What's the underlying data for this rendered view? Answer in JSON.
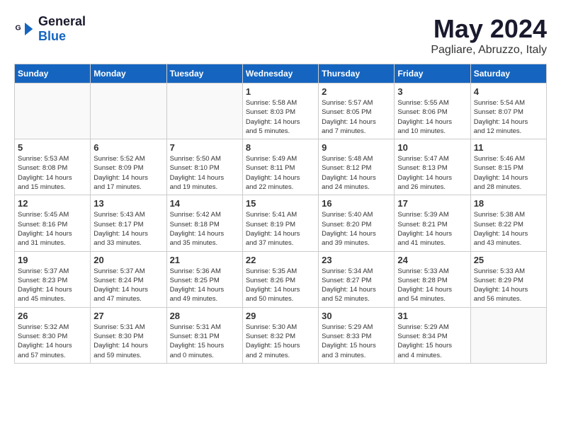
{
  "logo": {
    "general": "General",
    "blue": "Blue"
  },
  "header": {
    "month": "May 2024",
    "location": "Pagliare, Abruzzo, Italy"
  },
  "weekdays": [
    "Sunday",
    "Monday",
    "Tuesday",
    "Wednesday",
    "Thursday",
    "Friday",
    "Saturday"
  ],
  "weeks": [
    [
      {
        "day": "",
        "info": ""
      },
      {
        "day": "",
        "info": ""
      },
      {
        "day": "",
        "info": ""
      },
      {
        "day": "1",
        "info": "Sunrise: 5:58 AM\nSunset: 8:03 PM\nDaylight: 14 hours\nand 5 minutes."
      },
      {
        "day": "2",
        "info": "Sunrise: 5:57 AM\nSunset: 8:05 PM\nDaylight: 14 hours\nand 7 minutes."
      },
      {
        "day": "3",
        "info": "Sunrise: 5:55 AM\nSunset: 8:06 PM\nDaylight: 14 hours\nand 10 minutes."
      },
      {
        "day": "4",
        "info": "Sunrise: 5:54 AM\nSunset: 8:07 PM\nDaylight: 14 hours\nand 12 minutes."
      }
    ],
    [
      {
        "day": "5",
        "info": "Sunrise: 5:53 AM\nSunset: 8:08 PM\nDaylight: 14 hours\nand 15 minutes."
      },
      {
        "day": "6",
        "info": "Sunrise: 5:52 AM\nSunset: 8:09 PM\nDaylight: 14 hours\nand 17 minutes."
      },
      {
        "day": "7",
        "info": "Sunrise: 5:50 AM\nSunset: 8:10 PM\nDaylight: 14 hours\nand 19 minutes."
      },
      {
        "day": "8",
        "info": "Sunrise: 5:49 AM\nSunset: 8:11 PM\nDaylight: 14 hours\nand 22 minutes."
      },
      {
        "day": "9",
        "info": "Sunrise: 5:48 AM\nSunset: 8:12 PM\nDaylight: 14 hours\nand 24 minutes."
      },
      {
        "day": "10",
        "info": "Sunrise: 5:47 AM\nSunset: 8:13 PM\nDaylight: 14 hours\nand 26 minutes."
      },
      {
        "day": "11",
        "info": "Sunrise: 5:46 AM\nSunset: 8:15 PM\nDaylight: 14 hours\nand 28 minutes."
      }
    ],
    [
      {
        "day": "12",
        "info": "Sunrise: 5:45 AM\nSunset: 8:16 PM\nDaylight: 14 hours\nand 31 minutes."
      },
      {
        "day": "13",
        "info": "Sunrise: 5:43 AM\nSunset: 8:17 PM\nDaylight: 14 hours\nand 33 minutes."
      },
      {
        "day": "14",
        "info": "Sunrise: 5:42 AM\nSunset: 8:18 PM\nDaylight: 14 hours\nand 35 minutes."
      },
      {
        "day": "15",
        "info": "Sunrise: 5:41 AM\nSunset: 8:19 PM\nDaylight: 14 hours\nand 37 minutes."
      },
      {
        "day": "16",
        "info": "Sunrise: 5:40 AM\nSunset: 8:20 PM\nDaylight: 14 hours\nand 39 minutes."
      },
      {
        "day": "17",
        "info": "Sunrise: 5:39 AM\nSunset: 8:21 PM\nDaylight: 14 hours\nand 41 minutes."
      },
      {
        "day": "18",
        "info": "Sunrise: 5:38 AM\nSunset: 8:22 PM\nDaylight: 14 hours\nand 43 minutes."
      }
    ],
    [
      {
        "day": "19",
        "info": "Sunrise: 5:37 AM\nSunset: 8:23 PM\nDaylight: 14 hours\nand 45 minutes."
      },
      {
        "day": "20",
        "info": "Sunrise: 5:37 AM\nSunset: 8:24 PM\nDaylight: 14 hours\nand 47 minutes."
      },
      {
        "day": "21",
        "info": "Sunrise: 5:36 AM\nSunset: 8:25 PM\nDaylight: 14 hours\nand 49 minutes."
      },
      {
        "day": "22",
        "info": "Sunrise: 5:35 AM\nSunset: 8:26 PM\nDaylight: 14 hours\nand 50 minutes."
      },
      {
        "day": "23",
        "info": "Sunrise: 5:34 AM\nSunset: 8:27 PM\nDaylight: 14 hours\nand 52 minutes."
      },
      {
        "day": "24",
        "info": "Sunrise: 5:33 AM\nSunset: 8:28 PM\nDaylight: 14 hours\nand 54 minutes."
      },
      {
        "day": "25",
        "info": "Sunrise: 5:33 AM\nSunset: 8:29 PM\nDaylight: 14 hours\nand 56 minutes."
      }
    ],
    [
      {
        "day": "26",
        "info": "Sunrise: 5:32 AM\nSunset: 8:30 PM\nDaylight: 14 hours\nand 57 minutes."
      },
      {
        "day": "27",
        "info": "Sunrise: 5:31 AM\nSunset: 8:30 PM\nDaylight: 14 hours\nand 59 minutes."
      },
      {
        "day": "28",
        "info": "Sunrise: 5:31 AM\nSunset: 8:31 PM\nDaylight: 15 hours\nand 0 minutes."
      },
      {
        "day": "29",
        "info": "Sunrise: 5:30 AM\nSunset: 8:32 PM\nDaylight: 15 hours\nand 2 minutes."
      },
      {
        "day": "30",
        "info": "Sunrise: 5:29 AM\nSunset: 8:33 PM\nDaylight: 15 hours\nand 3 minutes."
      },
      {
        "day": "31",
        "info": "Sunrise: 5:29 AM\nSunset: 8:34 PM\nDaylight: 15 hours\nand 4 minutes."
      },
      {
        "day": "",
        "info": ""
      }
    ]
  ]
}
